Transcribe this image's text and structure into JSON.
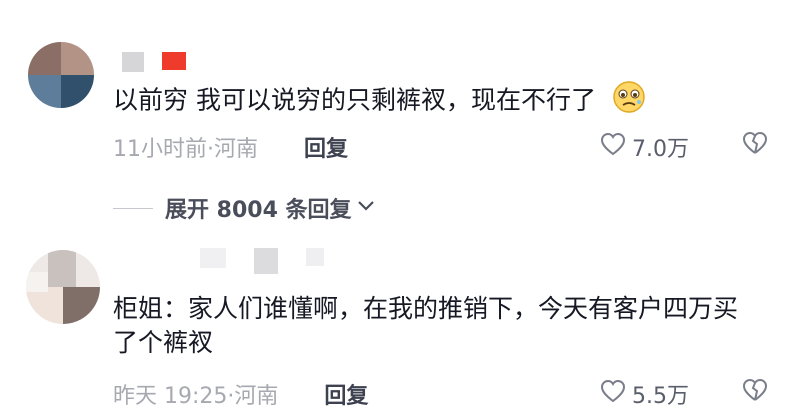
{
  "comments": [
    {
      "text": "以前穷  我可以说穷的只剩裤衩，现在不行了",
      "emoji": "worried-face-emoji",
      "time_location": "11小时前·河南",
      "reply_label": "回复",
      "likes": "7.0万"
    },
    {
      "text": "柜姐：家人们谁懂啊，在我的推销下，今天有客户四万买了个裤衩",
      "time_location": "昨天 19:25·河南",
      "reply_label": "回复",
      "likes": "5.5万"
    }
  ],
  "expand_replies": {
    "label": "展开 8004 条回复"
  },
  "colors": {
    "text": "#161823",
    "meta": "#a7a9b0",
    "reply": "#3d4150",
    "name_accent": "#ff3b30"
  }
}
